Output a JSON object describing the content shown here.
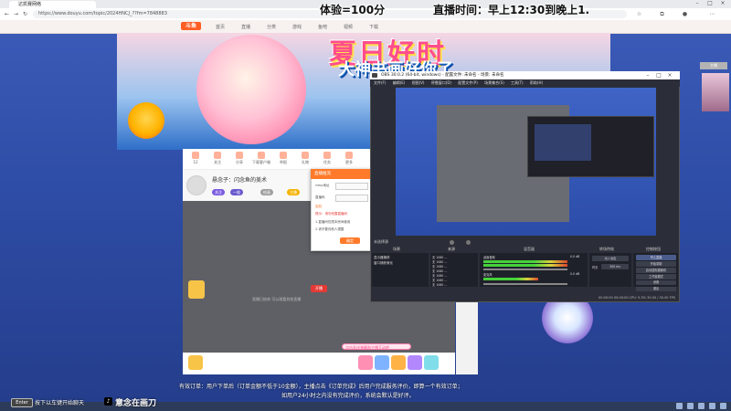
{
  "browser": {
    "tab_title": "达凯赛网络",
    "address": "https://www.douyu.com/topic/2024HNCJ_??fm=7848883"
  },
  "overlay": {
    "points": "体验=100分",
    "schedule": "直播时间：早上12:30到晚上1."
  },
  "site": {
    "logo": "斗鱼",
    "nav": [
      "首页",
      "直播",
      "分类",
      "游戏",
      "鱼吧",
      "视频",
      "下载"
    ]
  },
  "banner": {
    "title": "夏日好时",
    "subtitle": "大神书画好你了"
  },
  "room": {
    "tools": [
      "12",
      "关注",
      "分享",
      "下载客户端",
      "举报",
      "礼物",
      "任务",
      "更多"
    ],
    "streamer_name": "悬念子：闪念鱼的美术",
    "badges": [
      "关注",
      "一般",
      "绘画",
      "主播"
    ],
    "empty_text": "直播已结束 可以观看其他直播",
    "gift_input": "点击发送弹幕和主播互动吧",
    "red_button": "开播"
  },
  "popup": {
    "title": "直播推流",
    "lines": [
      "rtmp地址",
      "直播码",
      "复制",
      "提示：请勿泄露直播码",
      "1.直播码仅限本房间使用",
      "2.请不要向他人透露"
    ],
    "button": "确定"
  },
  "obs": {
    "title": "OBS 30.0.2 (64-bit, windows) - 配置文件: 未命名 - 场景: 未命名",
    "menu": [
      "文件(F)",
      "编辑(E)",
      "视图(V)",
      "停靠窗口(D)",
      "配置文件(P)",
      "场景集合(S)",
      "工具(T)",
      "帮助(H)"
    ],
    "dock_titles": [
      "场景",
      "来源",
      "混音器",
      "转场特效",
      "控制按钮"
    ],
    "no_source": "未选择源",
    "scenes": [
      "显示器捕获",
      "窗口捕获美化"
    ],
    "sources": [
      "无 1080 ...",
      "无 1080 ...",
      "无 1080 ...",
      "无 1080 ...",
      "无 1080 ...",
      "无 1080 ...",
      "无 1080 ...",
      "无 1080 ..."
    ],
    "mixer": [
      {
        "name": "桌面音频",
        "db": "0.0 dB"
      },
      {
        "name": "麦克风",
        "db": "0.0 dB"
      }
    ],
    "transition": "淡入淡出",
    "duration_label": "时长",
    "duration_value": "300 ms",
    "controls": [
      "停止直播",
      "开始录制",
      "启动虚拟摄像机",
      "工作室模式",
      "设置",
      "退出"
    ],
    "status": "00:00:00  00:00:00  CPU: 5.3%  30.00 / 30.00 FPS"
  },
  "side": {
    "thumb_label": "主播"
  },
  "bottom": {
    "notice1": "有效订单：用户下单后（订单金额不低于10金额），主播点击《订单完成》后用户完成服务评价，即算一个有效订单；",
    "notice2": "如用户24小时之内没有完成评价，系统会默认是好评。",
    "enter_key": "Enter",
    "hint": "按下以车键开始聊天",
    "tiktok_name": "意念在画刀"
  }
}
